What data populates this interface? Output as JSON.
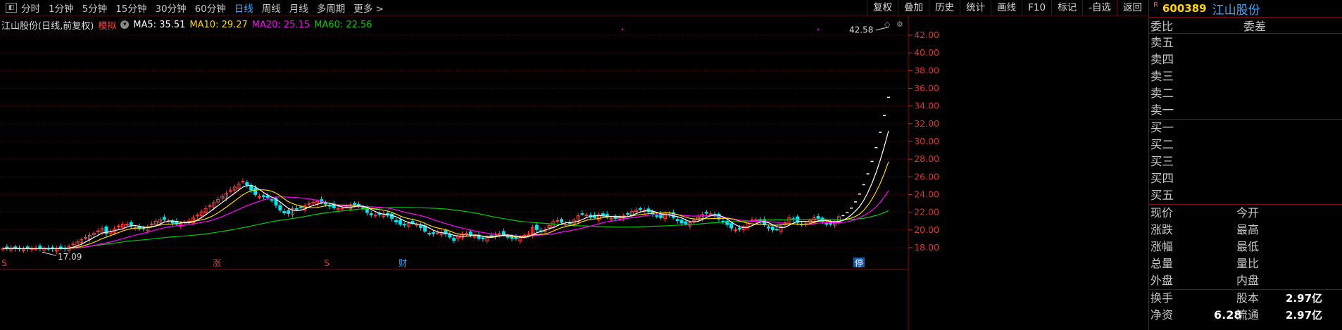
{
  "toolbar": {
    "periods": [
      "分时",
      "1分钟",
      "5分钟",
      "15分钟",
      "30分钟",
      "60分钟",
      "日线",
      "周线",
      "月线",
      "多周期",
      "更多 >"
    ],
    "active_period": "日线",
    "tools": [
      "复权",
      "叠加",
      "历史",
      "统计",
      "画线",
      "F10",
      "标记",
      "-自选",
      "返回"
    ]
  },
  "info": {
    "stock_label": "江山股份(日线,前复权)",
    "mode": "模拟",
    "ma5": "MA5: 35.51",
    "ma10": "MA10: 29.27",
    "ma20": "MA20: 25.15",
    "ma60": "MA60: 22.56"
  },
  "colors": {
    "ma5": "#ffffff",
    "ma10": "#ffd700",
    "ma20": "#ff00ff",
    "ma60": "#00cc00",
    "up": "#ff3b3b",
    "down": "#00e5ee"
  },
  "chart_data": {
    "type": "candlestick",
    "y_ticks": [
      "42.00",
      "40.00",
      "38.00",
      "36.00",
      "34.00",
      "32.00",
      "30.00",
      "28.00",
      "26.00",
      "24.00",
      "22.00",
      "20.00",
      "18.00"
    ],
    "ylim": [
      16.8,
      43.6
    ],
    "high_label": "42.58",
    "low_label": "17.09",
    "markers": [
      "S",
      "涨",
      "S",
      "财",
      "停"
    ]
  },
  "quote_header": {
    "r": "R",
    "code": "600389",
    "name": "江山股份"
  },
  "order_book": {
    "ratio_label": "委比",
    "diff_label": "委差",
    "sell": [
      "卖五",
      "卖四",
      "卖三",
      "卖二",
      "卖一"
    ],
    "buy": [
      "买一",
      "买二",
      "买三",
      "买四",
      "买五"
    ]
  },
  "quote_fields": [
    [
      "现价",
      "今开"
    ],
    [
      "涨跌",
      "最高"
    ],
    [
      "涨幅",
      "最低"
    ],
    [
      "总量",
      "量比"
    ],
    [
      "外盘",
      "内盘"
    ]
  ],
  "finance": {
    "turnover": "换手",
    "capital": "股本",
    "capital_value": "2.97亿",
    "net_asset": "净资",
    "net_asset_value": "6.28",
    "float": "流通",
    "float_value": "2.97亿"
  }
}
